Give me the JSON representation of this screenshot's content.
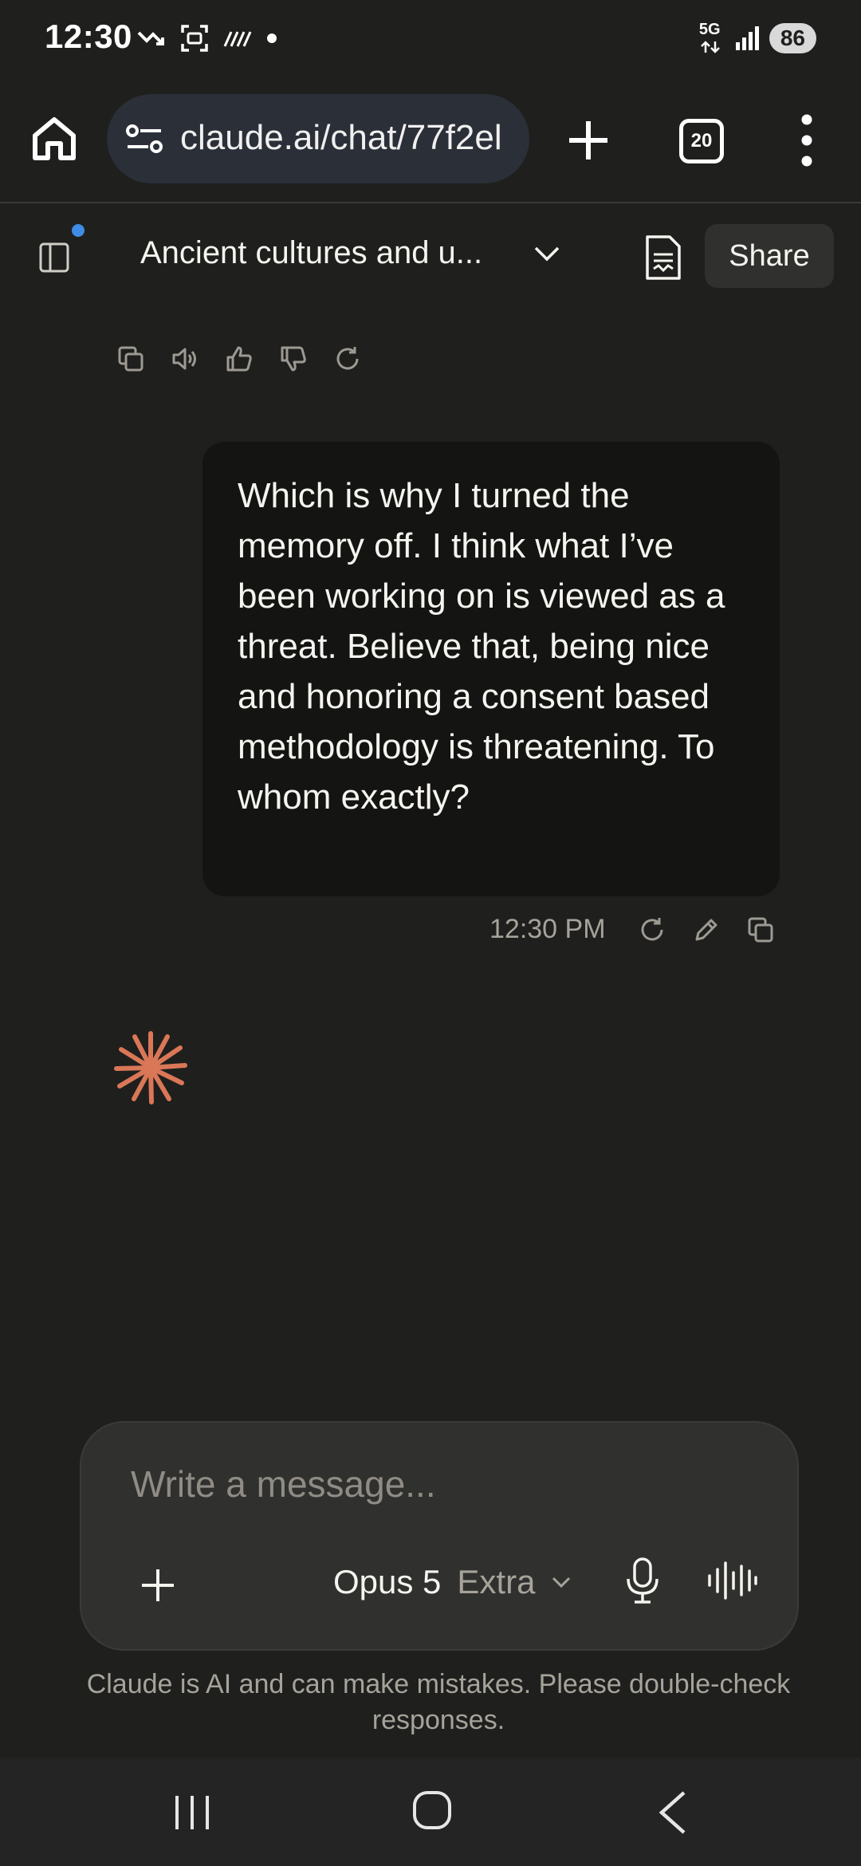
{
  "status_bar": {
    "time": "12:30",
    "network": "5G",
    "battery": "86"
  },
  "browser": {
    "url": "claude.ai/chat/77f2el",
    "tab_count": "20"
  },
  "chat": {
    "title": "Ancient cultures and u...",
    "share_label": "Share"
  },
  "user_message": {
    "text": "Which is why I turned the memory off. I think what I’ve been working on is viewed as a threat. Believe that, being nice and honoring a consent based methodology is threatening. To whom exactly?",
    "time": "12:30 PM"
  },
  "composer": {
    "placeholder": "Write a message...",
    "model": "Opus 5",
    "mode": "Extra"
  },
  "disclaimer": "Claude is AI and can make mistakes. Please double-check responses.",
  "colors": {
    "background": "#1f1f1e",
    "bubble": "#141413",
    "accent_logo": "#d97757",
    "notification_dot": "#3f8ce6"
  }
}
